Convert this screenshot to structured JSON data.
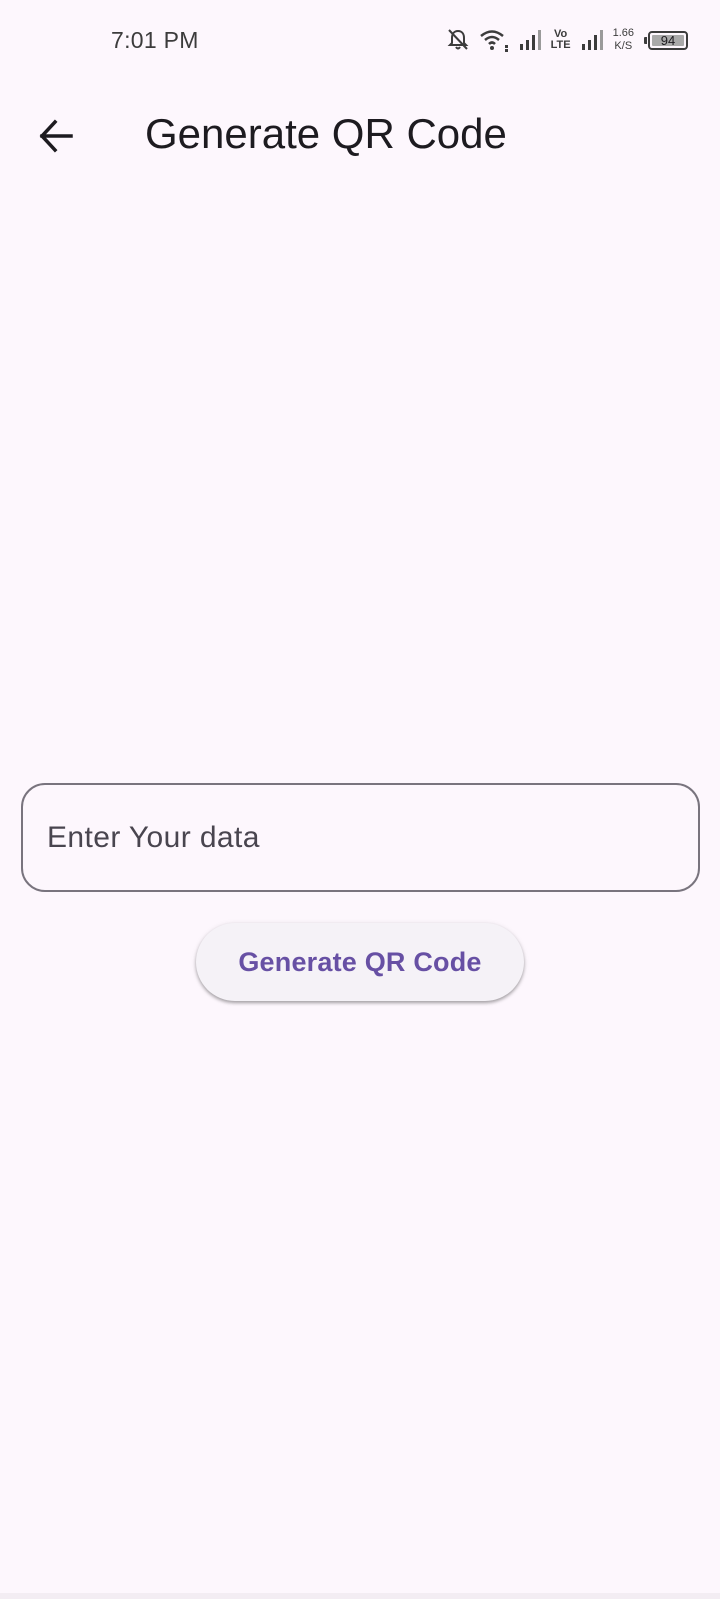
{
  "status_bar": {
    "time": "7:01 PM",
    "network_badge_top": "Vo",
    "network_badge_bottom": "LTE",
    "speed_value": "1.66",
    "speed_unit": "K/S",
    "battery_level": "94",
    "icons": [
      "bell-off-icon",
      "wifi-icon",
      "signal-icon",
      "volte-badge",
      "signal-icon",
      "speed-indicator",
      "battery-icon"
    ]
  },
  "app_bar": {
    "back_icon": "arrow-back-icon",
    "title": "Generate QR Code"
  },
  "form": {
    "input_placeholder": "Enter Your data",
    "input_value": "",
    "button_label": "Generate QR Code"
  },
  "colors": {
    "background": "#fdf7fd",
    "primary": "#6750a4",
    "outline": "#79747e",
    "button_surface": "#f5f2f7"
  }
}
